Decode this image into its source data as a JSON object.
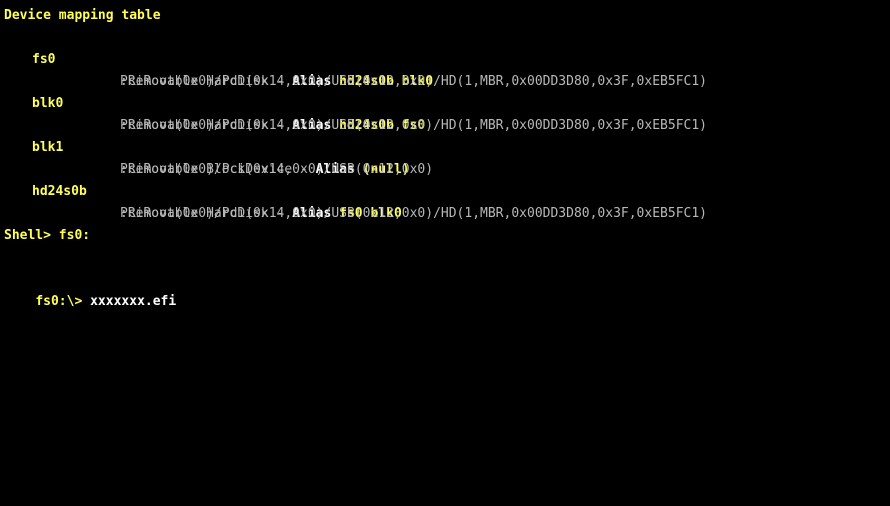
{
  "terminal": {
    "title": "Device mapping table",
    "entries": [
      {
        "handle": "fs0",
        "type": ":Removable HardDisk - ",
        "alias_label": "Alias",
        "aliases": "hd24s0b blk0",
        "path": "PciRoot(0x0)/Pci(0x14,0x0)/USB(0x12,0x0)/HD(1,MBR,0x00DD3D80,0x3F,0xEB5FC1)"
      },
      {
        "handle": "blk0",
        "type": ":Removable HardDisk - ",
        "alias_label": "Alias",
        "aliases": "hd24s0b fs0",
        "path": "PciRoot(0x0)/Pci(0x14,0x0)/USB(0x12,0x0)/HD(1,MBR,0x00DD3D80,0x3F,0xEB5FC1)"
      },
      {
        "handle": "blk1",
        "type": ":Removable BlockDevice - ",
        "alias_label": "Alias",
        "aliases": "(null)",
        "path": "PciRoot(0x0)/Pci(0x14,0x0)/USB(0x12,0x0)"
      },
      {
        "handle": "hd24s0b",
        "type": ":Removable HardDisk - ",
        "alias_label": "Alias",
        "aliases": "fs0 blk0",
        "path": "PciRoot(0x0)/Pci(0x14,0x0)/USB(0x12,0x0)/HD(1,MBR,0x00DD3D80,0x3F,0xEB5FC1)"
      }
    ],
    "prompt1": "Shell> fs0:",
    "prompt2_prefix": "fs0:\\> ",
    "prompt2_command": "xxxxxxx.efi",
    "colors": {
      "background": "#000000",
      "yellow": "#ffff55",
      "gray": "#b8b8b8",
      "white": "#ffffff"
    }
  }
}
